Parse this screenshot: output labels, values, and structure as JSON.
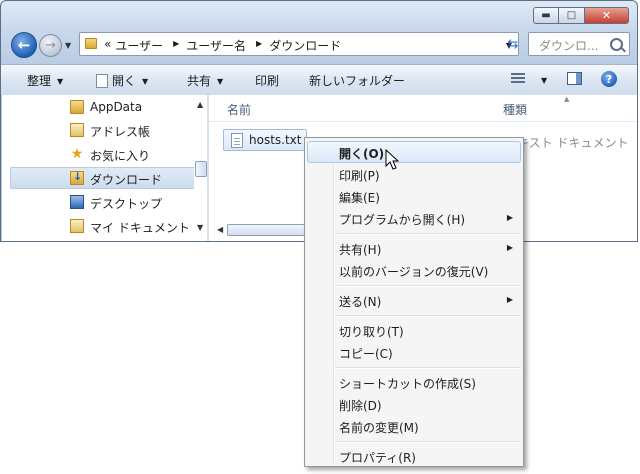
{
  "window": {
    "address_parts": [
      "«",
      "ユーザー",
      "ユーザー名",
      "ダウンロード"
    ],
    "search_placeholder": "ダウンロ...",
    "caption": {
      "minimize": "▬",
      "maximize": "□",
      "close": "✕"
    }
  },
  "toolbar": {
    "organize": "整理",
    "open": "開く",
    "share": "共有",
    "print": "印刷",
    "new_folder": "新しいフォルダー"
  },
  "nav": {
    "items": [
      {
        "label": "AppData",
        "icon": "folder-icon"
      },
      {
        "label": "アドレス帳",
        "icon": "contacts-folder-icon"
      },
      {
        "label": "お気に入り",
        "icon": "favorites-star-icon"
      },
      {
        "label": "ダウンロード",
        "icon": "downloads-folder-icon",
        "selected": true
      },
      {
        "label": "デスクトップ",
        "icon": "desktop-folder-icon"
      },
      {
        "label": "マイ ドキュメント",
        "icon": "documents-folder-icon"
      }
    ]
  },
  "content": {
    "columns": {
      "name": "名前",
      "type": "種類"
    },
    "files": [
      {
        "name": "hosts.txt",
        "type": "テキスト ドキュメント"
      }
    ]
  },
  "context_menu": {
    "items": [
      {
        "label": "開く(O)",
        "hot": true
      },
      {
        "label": "印刷(P)"
      },
      {
        "label": "編集(E)"
      },
      {
        "label": "プログラムから開く(H)",
        "submenu": true
      },
      {
        "label": "共有(H)",
        "submenu": true
      },
      {
        "label": "以前のバージョンの復元(V)"
      },
      {
        "label": "送る(N)",
        "submenu": true
      },
      {
        "label": "切り取り(T)"
      },
      {
        "label": "コピー(C)"
      },
      {
        "label": "ショートカットの作成(S)"
      },
      {
        "label": "削除(D)"
      },
      {
        "label": "名前の変更(M)"
      },
      {
        "label": "プロパティ(R)"
      }
    ]
  }
}
